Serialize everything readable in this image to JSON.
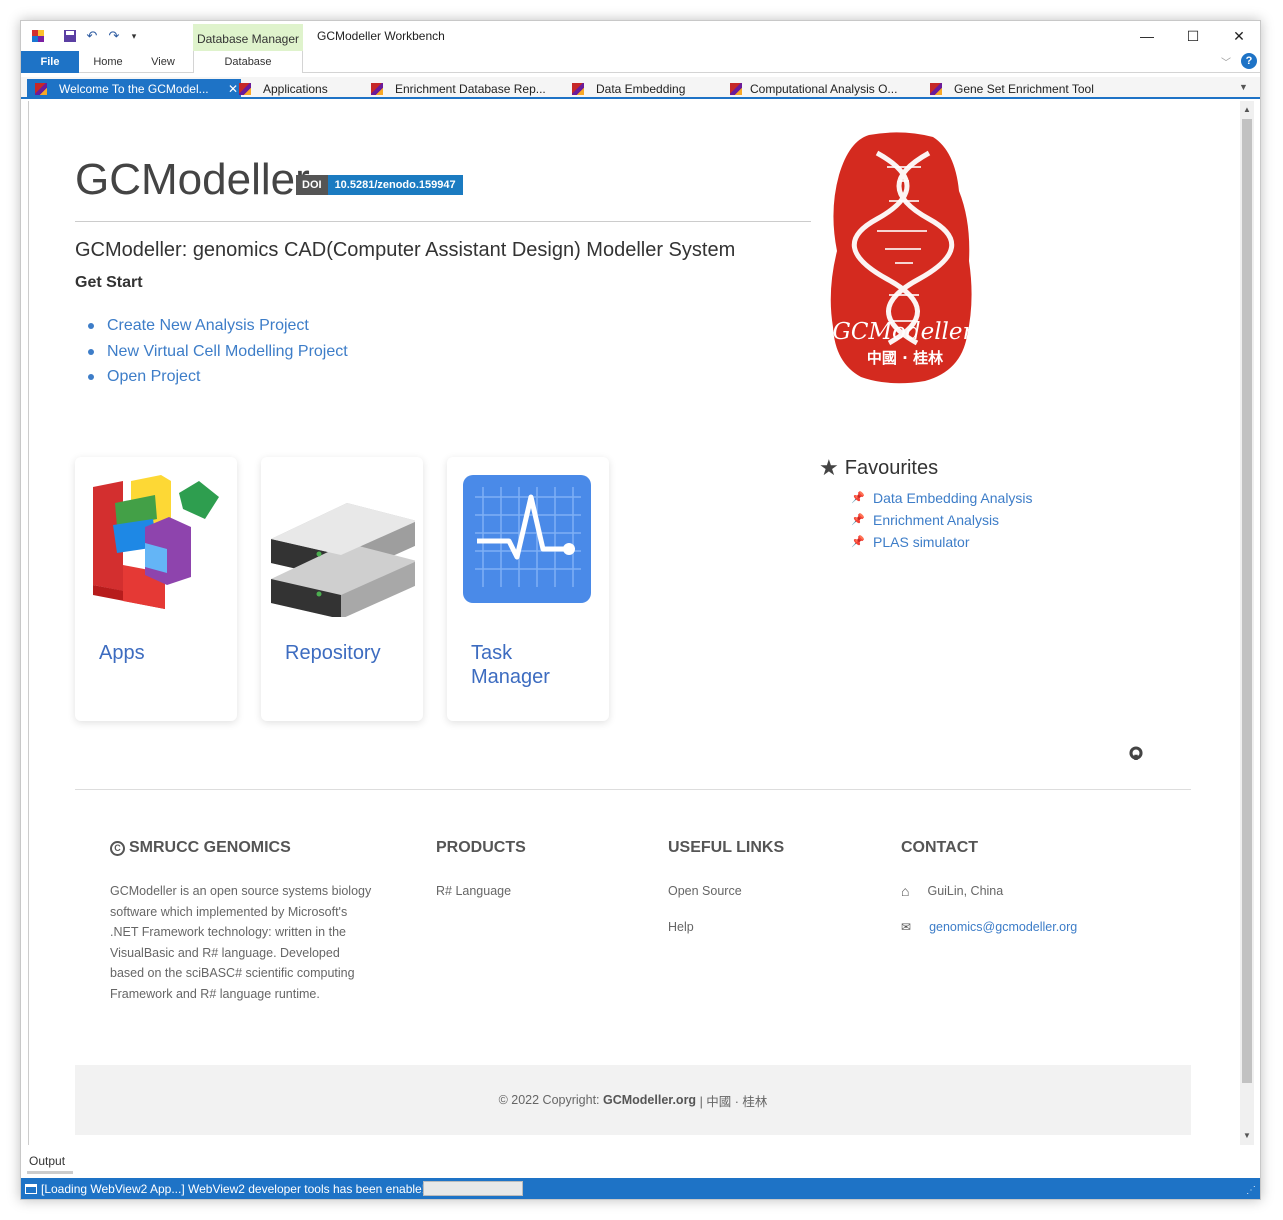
{
  "window": {
    "title": "GCModeller Workbench",
    "contextual_group": "Database Manager"
  },
  "ribbon": {
    "tabs": [
      "File",
      "Home",
      "View",
      "Database"
    ]
  },
  "doc_tabs": [
    {
      "label": "Welcome To the GCModel...",
      "active": true
    },
    {
      "label": "Applications"
    },
    {
      "label": "Enrichment Database Rep..."
    },
    {
      "label": "Data Embedding"
    },
    {
      "label": "Computational Analysis O..."
    },
    {
      "label": "Gene Set Enrichment Tool"
    }
  ],
  "page": {
    "title": "GCModeller",
    "doi_label": "DOI",
    "doi_value": "10.5281/zenodo.159947",
    "subtitle": "GCModeller: genomics CAD(Computer Assistant Design) Modeller System",
    "get_start": "Get Start",
    "start_links": [
      "Create New Analysis Project",
      "New Virtual Cell Modelling Project",
      "Open Project"
    ],
    "logo_text": "GCModeller",
    "logo_subtext": "中國 · 桂林",
    "cards": [
      {
        "title": "Apps",
        "icon": "apps-blocks-icon"
      },
      {
        "title": "Repository",
        "icon": "server-icon"
      },
      {
        "title": "Task Manager",
        "icon": "task-manager-chart-icon"
      }
    ],
    "favourites_title": "Favourites",
    "favourites": [
      "Data Embedding Analysis",
      "Enrichment Analysis",
      "PLAS simulator"
    ]
  },
  "footer": {
    "brand": "SMRUCC GENOMICS",
    "about": "GCModeller is an open source systems biology software which implemented by Microsoft's .NET Framework technology: written in the VisualBasic and R# language. Developed based on the sciBASC# scientific computing Framework and R# language runtime.",
    "products_title": "PRODUCTS",
    "products": [
      "R# Language"
    ],
    "useful_title": "USEFUL LINKS",
    "useful": [
      "Open Source",
      "Help"
    ],
    "contact_title": "CONTACT",
    "contact_location": "GuiLin, China",
    "contact_email": "genomics@gcmodeller.org",
    "copyright_prefix": "© 2022 Copyright:",
    "copyright_site": "GCModeller.org",
    "copyright_suffix": "| 中國 · 桂林"
  },
  "output": {
    "label": "Output"
  },
  "status": {
    "text": "[Loading WebView2 App...] WebView2 developer tools has been enable!"
  },
  "colors": {
    "accent": "#1e73c6",
    "link": "#3d7dc8",
    "logo_red": "#d42a1f",
    "doi_blue": "#1b7bc1"
  }
}
